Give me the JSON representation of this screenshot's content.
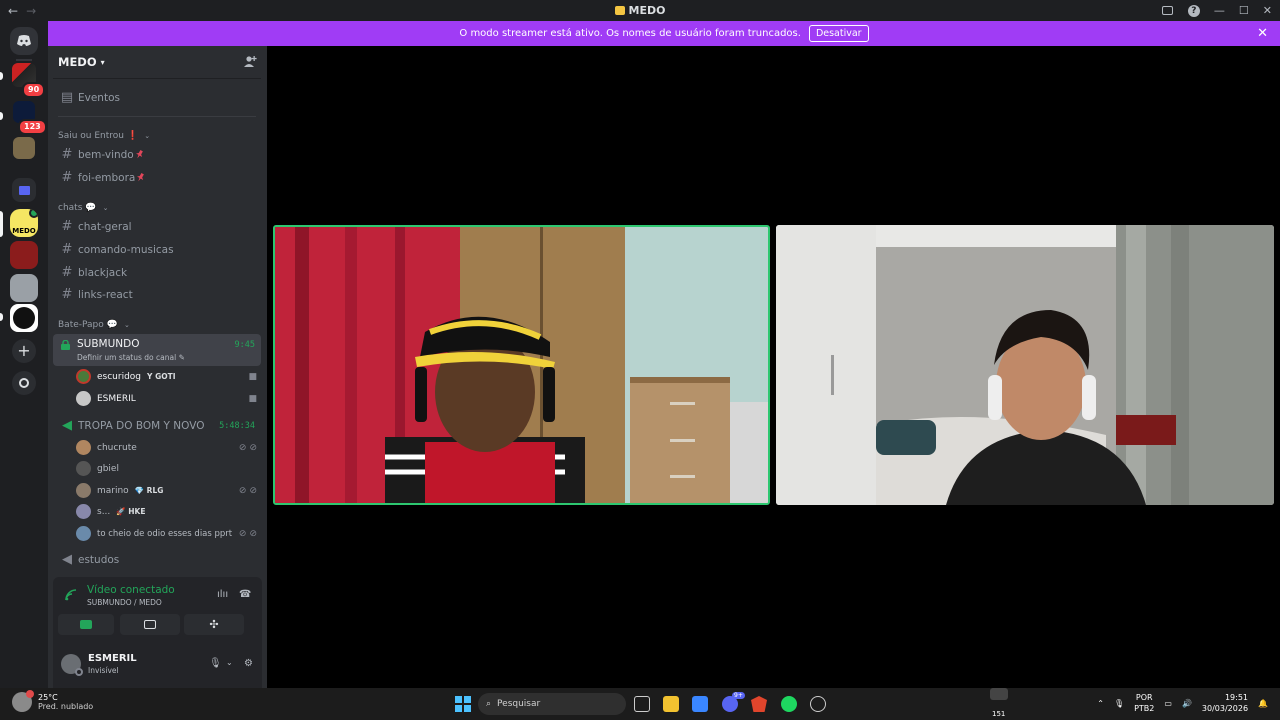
{
  "window": {
    "title": "MEDO",
    "back_arrow": "←",
    "forward_arrow": "→",
    "minimize": "—",
    "maximize": "☐",
    "close": "✕"
  },
  "rail": {
    "badges": [
      "90",
      "123"
    ]
  },
  "banner": {
    "message": "O modo streamer está ativo. Os nomes de usuário foram truncados.",
    "button": "Desativar",
    "close": "✕"
  },
  "server": {
    "name": "MEDO",
    "events_label": "Eventos",
    "categories": [
      {
        "name": "Saiu ou Entrou",
        "marker": "❗"
      },
      {
        "name": "chats",
        "marker": "💬"
      },
      {
        "name": "Bate-Papo",
        "marker": "💬"
      }
    ],
    "text_channels_1": [
      "bem-vindo",
      "foi-embora"
    ],
    "text_channels_2": [
      "chat-geral",
      "comando-musicas",
      "blackjack",
      "links-react"
    ],
    "active_voice": {
      "name": "SUBMUNDO",
      "status": "Definir um status do canal",
      "time": "9:45",
      "members": [
        {
          "name": "escuridog",
          "tag": "GOTI",
          "tag_icon": "Y"
        },
        {
          "name": "ESMERIL",
          "tag": "",
          "tag_icon": ""
        }
      ]
    },
    "voice2": {
      "name": "TROPA DO BOM Y NOVO",
      "time": "5:48:34",
      "members": [
        {
          "name": "chucrute",
          "tag": "",
          "tag_icon": ""
        },
        {
          "name": "gbiel",
          "tag": "",
          "tag_icon": ""
        },
        {
          "name": "marino",
          "tag": "RLG",
          "tag_icon": "💎"
        },
        {
          "name": "s...",
          "tag": "HKE",
          "tag_icon": "🚀"
        },
        {
          "name": "to cheio de odio esses dias pprt",
          "tag": "",
          "tag_icon": ""
        }
      ]
    },
    "voice3": {
      "name": "estudos"
    }
  },
  "voice_panel": {
    "status": "Vídeo conectado",
    "location": "SUBMUNDO / MEDO"
  },
  "user": {
    "name": "ESMERIL",
    "status": "Invisível"
  },
  "taskbar": {
    "temp": "25°C",
    "weather": "Pred. nublado",
    "search_placeholder": "Pesquisar",
    "notif_count": "151",
    "discord_badge": "9+",
    "lang_1": "POR",
    "lang_2": "PTB2",
    "time": "19:51",
    "date": "30/03/2026"
  },
  "colors": {
    "banner": "#a03cf5",
    "connected_green": "#23a55a",
    "speaking_border": "#2dc770"
  }
}
